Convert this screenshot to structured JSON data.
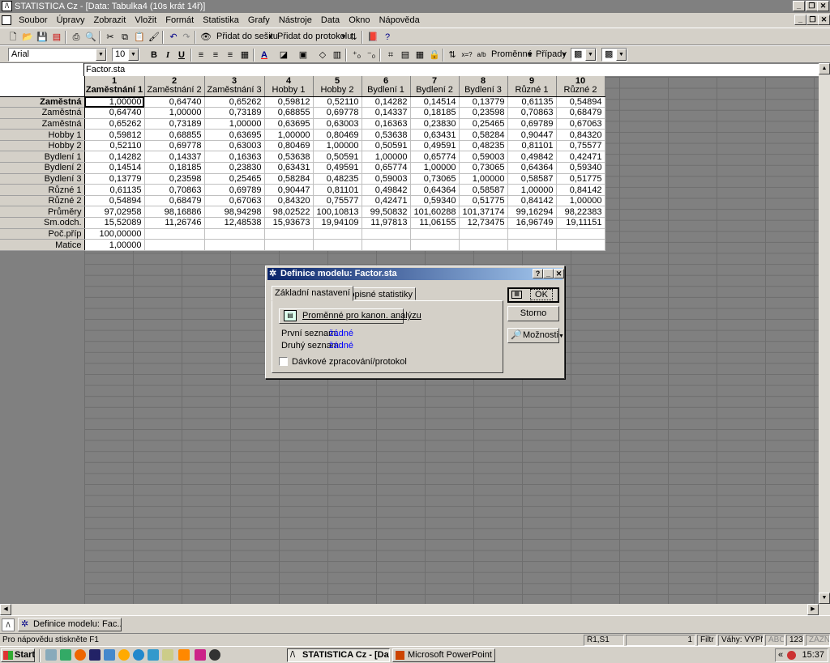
{
  "window": {
    "title": "STATISTICA Cz - [Data: Tabulka4 (10s krát 14ř)]",
    "minimize": "_",
    "restore": "❐",
    "close": "✕"
  },
  "menu": [
    "Soubor",
    "Úpravy",
    "Zobrazit",
    "Vložit",
    "Formát",
    "Statistika",
    "Grafy",
    "Nástroje",
    "Data",
    "Okno",
    "Nápověda"
  ],
  "toolbar1": {
    "add_to_workbook": "Přidat do sešitu",
    "add_to_report": "Přidat do protokolu"
  },
  "toolbar2": {
    "font": "Arial",
    "size": "10",
    "bold": "B",
    "italic": "I",
    "underline": "U",
    "variables": "Proměnné",
    "cases": "Případy"
  },
  "sheet": {
    "name": "Factor.sta",
    "columns": [
      {
        "num": "1",
        "name": "Zaměstnání 1"
      },
      {
        "num": "2",
        "name": "Zaměstnání 2"
      },
      {
        "num": "3",
        "name": "Zaměstnání 3"
      },
      {
        "num": "4",
        "name": "Hobby 1"
      },
      {
        "num": "5",
        "name": "Hobby 2"
      },
      {
        "num": "6",
        "name": "Bydlení 1"
      },
      {
        "num": "7",
        "name": "Bydlení 2"
      },
      {
        "num": "8",
        "name": "Bydlení 3"
      },
      {
        "num": "9",
        "name": "Různé 1"
      },
      {
        "num": "10",
        "name": "Různé 2"
      }
    ],
    "rows": [
      {
        "label": "Zaměstná",
        "cells": [
          "1,00000",
          "0,64740",
          "0,65262",
          "0,59812",
          "0,52110",
          "0,14282",
          "0,14514",
          "0,13779",
          "0,61135",
          "0,54894"
        ]
      },
      {
        "label": "Zaměstná",
        "cells": [
          "0,64740",
          "1,00000",
          "0,73189",
          "0,68855",
          "0,69778",
          "0,14337",
          "0,18185",
          "0,23598",
          "0,70863",
          "0,68479"
        ]
      },
      {
        "label": "Zaměstná",
        "cells": [
          "0,65262",
          "0,73189",
          "1,00000",
          "0,63695",
          "0,63003",
          "0,16363",
          "0,23830",
          "0,25465",
          "0,69789",
          "0,67063"
        ]
      },
      {
        "label": "Hobby 1",
        "cells": [
          "0,59812",
          "0,68855",
          "0,63695",
          "1,00000",
          "0,80469",
          "0,53638",
          "0,63431",
          "0,58284",
          "0,90447",
          "0,84320"
        ]
      },
      {
        "label": "Hobby 2",
        "cells": [
          "0,52110",
          "0,69778",
          "0,63003",
          "0,80469",
          "1,00000",
          "0,50591",
          "0,49591",
          "0,48235",
          "0,81101",
          "0,75577"
        ]
      },
      {
        "label": "Bydlení 1",
        "cells": [
          "0,14282",
          "0,14337",
          "0,16363",
          "0,53638",
          "0,50591",
          "1,00000",
          "0,65774",
          "0,59003",
          "0,49842",
          "0,42471"
        ]
      },
      {
        "label": "Bydlení 2",
        "cells": [
          "0,14514",
          "0,18185",
          "0,23830",
          "0,63431",
          "0,49591",
          "0,65774",
          "1,00000",
          "0,73065",
          "0,64364",
          "0,59340"
        ]
      },
      {
        "label": "Bydlení 3",
        "cells": [
          "0,13779",
          "0,23598",
          "0,25465",
          "0,58284",
          "0,48235",
          "0,59003",
          "0,73065",
          "1,00000",
          "0,58587",
          "0,51775"
        ]
      },
      {
        "label": "Různé 1",
        "cells": [
          "0,61135",
          "0,70863",
          "0,69789",
          "0,90447",
          "0,81101",
          "0,49842",
          "0,64364",
          "0,58587",
          "1,00000",
          "0,84142"
        ]
      },
      {
        "label": "Různé 2",
        "cells": [
          "0,54894",
          "0,68479",
          "0,67063",
          "0,84320",
          "0,75577",
          "0,42471",
          "0,59340",
          "0,51775",
          "0,84142",
          "1,00000"
        ]
      },
      {
        "label": "Průměry",
        "cells": [
          "97,02958",
          "98,16886",
          "98,94298",
          "98,02522",
          "100,10813",
          "99,50832",
          "101,60288",
          "101,37174",
          "99,16294",
          "98,22383"
        ]
      },
      {
        "label": "Sm.odch.",
        "cells": [
          "15,52089",
          "11,26746",
          "12,48538",
          "15,93673",
          "19,94109",
          "11,97813",
          "11,06155",
          "12,73475",
          "16,96749",
          "19,11151"
        ]
      },
      {
        "label": "Poč.příp",
        "cells": [
          "100,00000",
          "",
          "",
          "",
          "",
          "",
          "",
          "",
          "",
          ""
        ]
      },
      {
        "label": "Matice",
        "cells": [
          "1,00000",
          "",
          "",
          "",
          "",
          "",
          "",
          "",
          "",
          ""
        ]
      }
    ]
  },
  "dialog": {
    "title": "Definice modelu: Factor.sta",
    "help": "?",
    "tab_basic": "Základní nastavení",
    "tab_stats": "Popisné statistiky",
    "variables_button": "Proměnné pro kanon. analýzu",
    "first_list_label": "První seznam:",
    "first_list_value": "žádné",
    "second_list_label": "Druhý seznam:",
    "second_list_value": "žádné",
    "batch_label": "Dávkové zpracování/protokol",
    "ok": "OK",
    "cancel": "Storno",
    "options": "Možnosti"
  },
  "task_window": {
    "label": "Definice modelu: Fac..."
  },
  "status": {
    "help": "Pro nápovědu stiskněte F1",
    "cell": "Ř1,S1",
    "count": "1",
    "filter": "Filtr -",
    "weights": "Váhy: VYPN",
    "abc": "ABC",
    "num": "123",
    "rec": "ZÁZN"
  },
  "taskbar": {
    "start": "Start",
    "task1": "STATISTICA Cz - [Dat...",
    "task2": "Microsoft PowerPoint - [...",
    "clock": "15:37"
  }
}
